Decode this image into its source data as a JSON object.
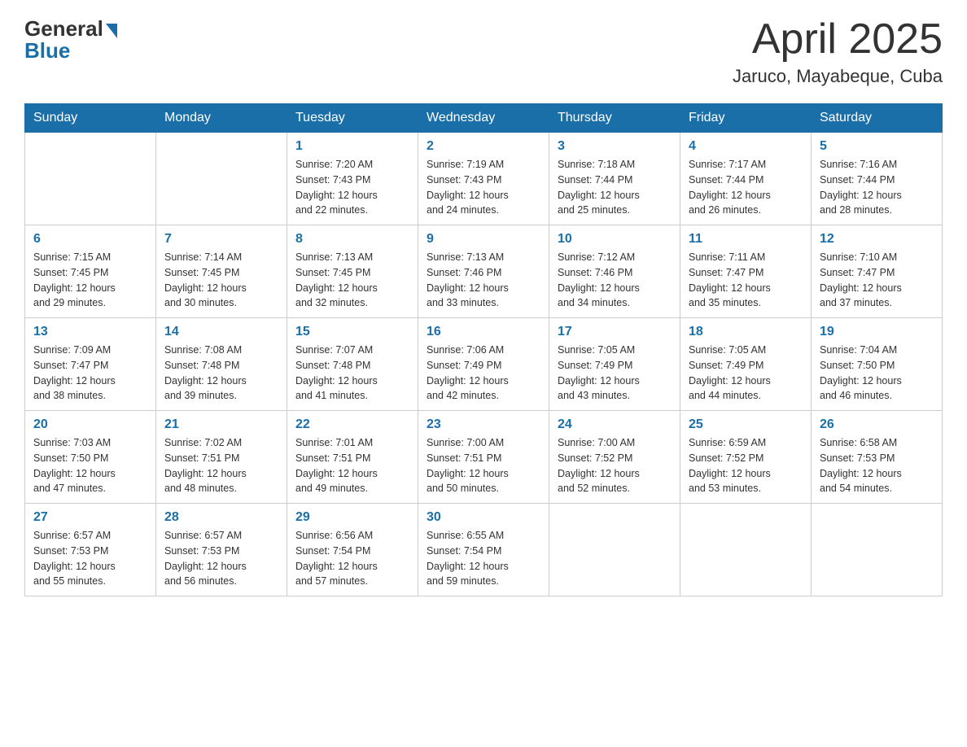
{
  "header": {
    "logo_general": "General",
    "logo_blue": "Blue",
    "month_title": "April 2025",
    "location": "Jaruco, Mayabeque, Cuba"
  },
  "weekdays": [
    "Sunday",
    "Monday",
    "Tuesday",
    "Wednesday",
    "Thursday",
    "Friday",
    "Saturday"
  ],
  "weeks": [
    [
      {
        "day": "",
        "info": ""
      },
      {
        "day": "",
        "info": ""
      },
      {
        "day": "1",
        "info": "Sunrise: 7:20 AM\nSunset: 7:43 PM\nDaylight: 12 hours\nand 22 minutes."
      },
      {
        "day": "2",
        "info": "Sunrise: 7:19 AM\nSunset: 7:43 PM\nDaylight: 12 hours\nand 24 minutes."
      },
      {
        "day": "3",
        "info": "Sunrise: 7:18 AM\nSunset: 7:44 PM\nDaylight: 12 hours\nand 25 minutes."
      },
      {
        "day": "4",
        "info": "Sunrise: 7:17 AM\nSunset: 7:44 PM\nDaylight: 12 hours\nand 26 minutes."
      },
      {
        "day": "5",
        "info": "Sunrise: 7:16 AM\nSunset: 7:44 PM\nDaylight: 12 hours\nand 28 minutes."
      }
    ],
    [
      {
        "day": "6",
        "info": "Sunrise: 7:15 AM\nSunset: 7:45 PM\nDaylight: 12 hours\nand 29 minutes."
      },
      {
        "day": "7",
        "info": "Sunrise: 7:14 AM\nSunset: 7:45 PM\nDaylight: 12 hours\nand 30 minutes."
      },
      {
        "day": "8",
        "info": "Sunrise: 7:13 AM\nSunset: 7:45 PM\nDaylight: 12 hours\nand 32 minutes."
      },
      {
        "day": "9",
        "info": "Sunrise: 7:13 AM\nSunset: 7:46 PM\nDaylight: 12 hours\nand 33 minutes."
      },
      {
        "day": "10",
        "info": "Sunrise: 7:12 AM\nSunset: 7:46 PM\nDaylight: 12 hours\nand 34 minutes."
      },
      {
        "day": "11",
        "info": "Sunrise: 7:11 AM\nSunset: 7:47 PM\nDaylight: 12 hours\nand 35 minutes."
      },
      {
        "day": "12",
        "info": "Sunrise: 7:10 AM\nSunset: 7:47 PM\nDaylight: 12 hours\nand 37 minutes."
      }
    ],
    [
      {
        "day": "13",
        "info": "Sunrise: 7:09 AM\nSunset: 7:47 PM\nDaylight: 12 hours\nand 38 minutes."
      },
      {
        "day": "14",
        "info": "Sunrise: 7:08 AM\nSunset: 7:48 PM\nDaylight: 12 hours\nand 39 minutes."
      },
      {
        "day": "15",
        "info": "Sunrise: 7:07 AM\nSunset: 7:48 PM\nDaylight: 12 hours\nand 41 minutes."
      },
      {
        "day": "16",
        "info": "Sunrise: 7:06 AM\nSunset: 7:49 PM\nDaylight: 12 hours\nand 42 minutes."
      },
      {
        "day": "17",
        "info": "Sunrise: 7:05 AM\nSunset: 7:49 PM\nDaylight: 12 hours\nand 43 minutes."
      },
      {
        "day": "18",
        "info": "Sunrise: 7:05 AM\nSunset: 7:49 PM\nDaylight: 12 hours\nand 44 minutes."
      },
      {
        "day": "19",
        "info": "Sunrise: 7:04 AM\nSunset: 7:50 PM\nDaylight: 12 hours\nand 46 minutes."
      }
    ],
    [
      {
        "day": "20",
        "info": "Sunrise: 7:03 AM\nSunset: 7:50 PM\nDaylight: 12 hours\nand 47 minutes."
      },
      {
        "day": "21",
        "info": "Sunrise: 7:02 AM\nSunset: 7:51 PM\nDaylight: 12 hours\nand 48 minutes."
      },
      {
        "day": "22",
        "info": "Sunrise: 7:01 AM\nSunset: 7:51 PM\nDaylight: 12 hours\nand 49 minutes."
      },
      {
        "day": "23",
        "info": "Sunrise: 7:00 AM\nSunset: 7:51 PM\nDaylight: 12 hours\nand 50 minutes."
      },
      {
        "day": "24",
        "info": "Sunrise: 7:00 AM\nSunset: 7:52 PM\nDaylight: 12 hours\nand 52 minutes."
      },
      {
        "day": "25",
        "info": "Sunrise: 6:59 AM\nSunset: 7:52 PM\nDaylight: 12 hours\nand 53 minutes."
      },
      {
        "day": "26",
        "info": "Sunrise: 6:58 AM\nSunset: 7:53 PM\nDaylight: 12 hours\nand 54 minutes."
      }
    ],
    [
      {
        "day": "27",
        "info": "Sunrise: 6:57 AM\nSunset: 7:53 PM\nDaylight: 12 hours\nand 55 minutes."
      },
      {
        "day": "28",
        "info": "Sunrise: 6:57 AM\nSunset: 7:53 PM\nDaylight: 12 hours\nand 56 minutes."
      },
      {
        "day": "29",
        "info": "Sunrise: 6:56 AM\nSunset: 7:54 PM\nDaylight: 12 hours\nand 57 minutes."
      },
      {
        "day": "30",
        "info": "Sunrise: 6:55 AM\nSunset: 7:54 PM\nDaylight: 12 hours\nand 59 minutes."
      },
      {
        "day": "",
        "info": ""
      },
      {
        "day": "",
        "info": ""
      },
      {
        "day": "",
        "info": ""
      }
    ]
  ]
}
